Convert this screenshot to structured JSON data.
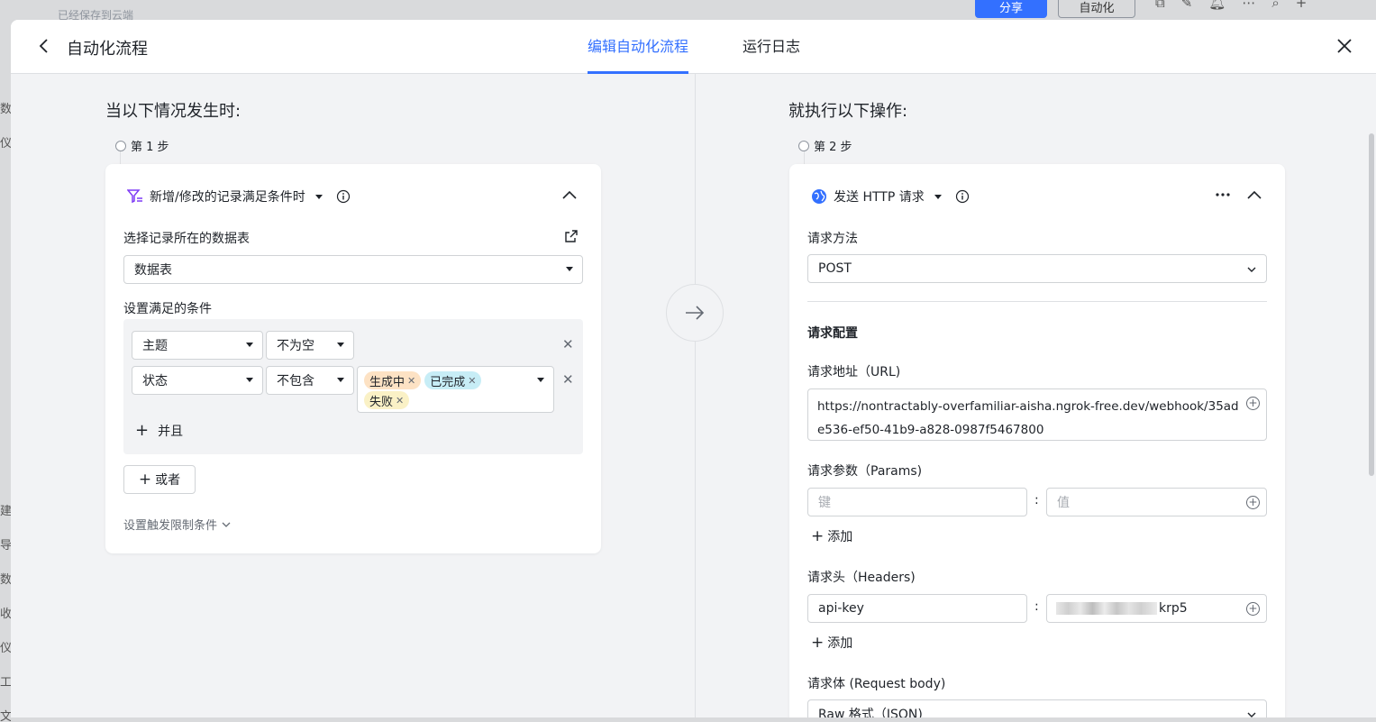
{
  "backdrop": {
    "saved_text": "已经保存到云端",
    "share_label": "分享",
    "automation_label": "自动化",
    "left_chars": [
      "数",
      "仪",
      "建",
      "导",
      "数",
      "收",
      "仪",
      "工",
      "文"
    ]
  },
  "header": {
    "title": "自动化流程",
    "tabs": [
      {
        "label": "编辑自动化流程",
        "active": true
      },
      {
        "label": "运行日志",
        "active": false
      }
    ]
  },
  "trigger": {
    "section_title": "当以下情况发生时:",
    "step_label": "第 1 步",
    "type_label": "新增/修改的记录满足条件时",
    "table_label": "选择记录所在的数据表",
    "table_value": "数据表",
    "conditions_label": "设置满足的条件",
    "conditions": [
      {
        "field": "主题",
        "operator": "不为空"
      },
      {
        "field": "状态",
        "operator": "不包含",
        "values": [
          "生成中",
          "已完成",
          "失败"
        ]
      }
    ],
    "and_label": "并且",
    "or_label": "或者",
    "limit_label": "设置触发限制条件"
  },
  "action": {
    "section_title": "就执行以下操作:",
    "step_label": "第 2 步",
    "type_label": "发送 HTTP 请求",
    "method_label": "请求方法",
    "method_value": "POST",
    "config_label": "请求配置",
    "url_label": "请求地址（URL)",
    "url_value": "https://nontractably-overfamiliar-aisha.ngrok-free.dev/webhook/35ade536-ef50-41b9-a828-0987f5467800",
    "params_label": "请求参数（Params)",
    "params_key_placeholder": "键",
    "params_value_placeholder": "值",
    "add_label": "添加",
    "headers_label": "请求头（Headers)",
    "header_key": "api-key",
    "header_value_visible": "krp5",
    "body_label": "请求体 (Request body)",
    "body_value": "Raw 格式（JSON)"
  },
  "colors": {
    "accent": "#3370ff",
    "tag_orange": "#fde2c4",
    "tag_blue": "#c7edf6",
    "tag_yellow": "#faf1c6"
  }
}
